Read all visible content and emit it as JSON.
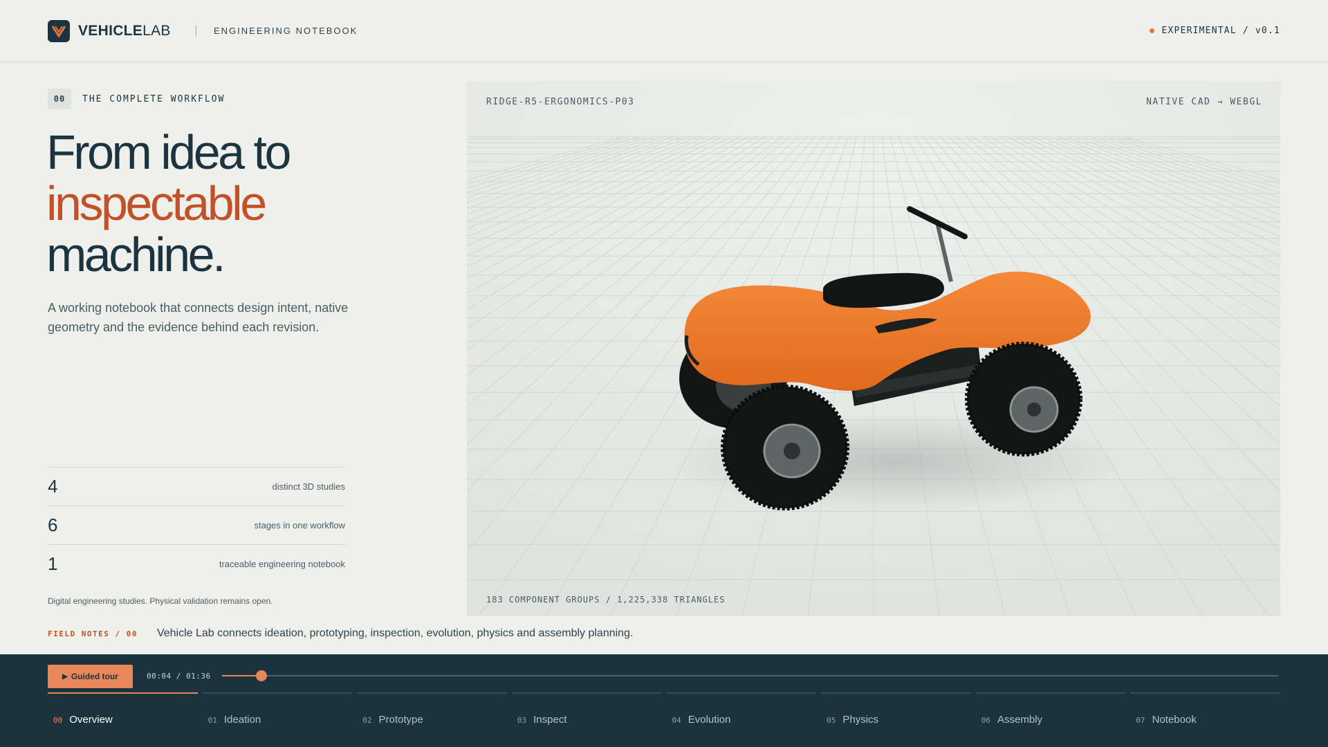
{
  "brand": {
    "name_bold": "VEHICLE",
    "name_light": "LAB",
    "section": "ENGINEERING NOTEBOOK",
    "status": "EXPERIMENTAL / v0.1"
  },
  "intro": {
    "number": "00",
    "label": "THE COMPLETE WORKFLOW",
    "headline_1": "From idea to",
    "headline_accent": "inspectable",
    "headline_2": "machine.",
    "lead": "A working notebook that connects design intent, native geometry and the evidence behind each revision."
  },
  "stats": [
    {
      "value": "4",
      "label": "distinct 3D studies"
    },
    {
      "value": "6",
      "label": "stages in one workflow"
    },
    {
      "value": "1",
      "label": "traceable engineering notebook"
    }
  ],
  "disclaimer": "Digital engineering studies. Physical validation remains open.",
  "viewer": {
    "model_id": "RIDGE-R5-ERGONOMICS-P03",
    "pipeline": "NATIVE CAD → WEBGL",
    "mesh_stats": "183 COMPONENT GROUPS / 1,225,338 TRIANGLES"
  },
  "field_notes": {
    "tag": "FIELD NOTES / 00",
    "text": "Vehicle Lab connects ideation, prototyping, inspection, evolution, physics and assembly planning."
  },
  "player": {
    "button_label": "Guided tour",
    "time": "00:04 / 01:36",
    "progress": 0.0375
  },
  "chapters": [
    {
      "num": "00",
      "label": "Overview",
      "active": true
    },
    {
      "num": "01",
      "label": "Ideation",
      "active": false
    },
    {
      "num": "02",
      "label": "Prototype",
      "active": false
    },
    {
      "num": "03",
      "label": "Inspect",
      "active": false
    },
    {
      "num": "04",
      "label": "Evolution",
      "active": false
    },
    {
      "num": "05",
      "label": "Physics",
      "active": false
    },
    {
      "num": "06",
      "label": "Assembly",
      "active": false
    },
    {
      "num": "07",
      "label": "Notebook",
      "active": false
    }
  ],
  "colors": {
    "accent": "#e8885a",
    "accent_dark": "#c25029",
    "ink": "#1c3440",
    "bar": "#1a333d",
    "body_orange": "#f07a2c"
  }
}
